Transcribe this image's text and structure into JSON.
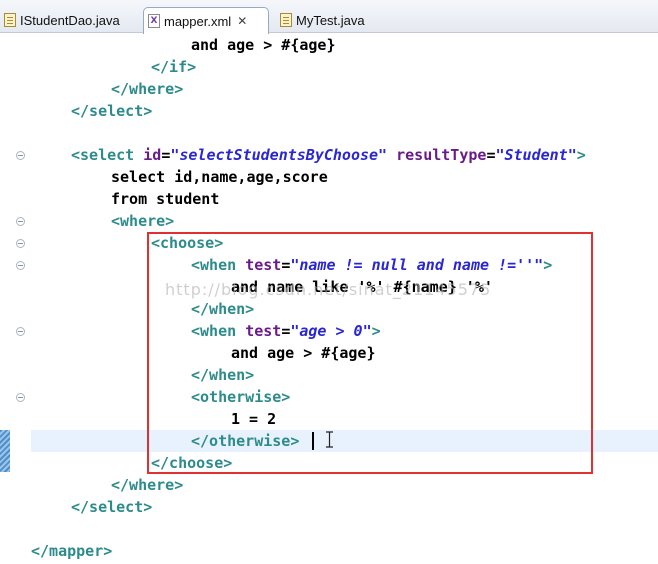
{
  "tabs": [
    {
      "label": "IStudentDao.java"
    },
    {
      "label": "mapper.xml",
      "close": "✕"
    },
    {
      "label": "MyTest.java"
    }
  ],
  "watermark": "http://blog.csdn.net/sinat_21145575",
  "code": [
    {
      "text": "and age > #{age}"
    },
    {
      "text": "</if>"
    },
    {
      "text": "</where>"
    },
    {
      "text": "</select>"
    },
    {
      "text": ""
    },
    {
      "p1": "<select ",
      "p2": "id",
      "p3": "=",
      "p4": "\"selectStudentsByChoose\"",
      "p5": " resultType",
      "p6": "=",
      "p7": "\"Student\"",
      "p8": ">"
    },
    {
      "text": "select id,name,age,score"
    },
    {
      "text": "from student"
    },
    {
      "text": "<where>"
    },
    {
      "text": "<choose>"
    },
    {
      "p1": "<when ",
      "p2": "test",
      "p3": "=",
      "p4": "\"name != null and name !=''\"",
      "p5": ">"
    },
    {
      "text": "and name like '%' #{name} '%'"
    },
    {
      "text": "</when>"
    },
    {
      "p1": "<when ",
      "p2": "test",
      "p3": "=",
      "p4": "\"age > 0\"",
      "p5": ">"
    },
    {
      "text": "and age > #{age}"
    },
    {
      "text": "</when>"
    },
    {
      "text": "<otherwise>"
    },
    {
      "text": "1 = 2"
    },
    {
      "text": "</otherwise>"
    },
    {
      "text": "</choose>"
    },
    {
      "text": "</where>"
    },
    {
      "text": "</select>"
    },
    {
      "text": ""
    },
    {
      "text": "</mapper>"
    }
  ],
  "colors": {
    "tag": "#2e8b8b",
    "attribute": "#6a1b8a",
    "value": "#2a26d4",
    "highlight_box": "#e03030",
    "current_line": "#e8f2fe"
  },
  "icons": [
    "java-file-icon",
    "xml-file-icon",
    "close-icon",
    "fold-icon",
    "text-cursor-icon"
  ]
}
